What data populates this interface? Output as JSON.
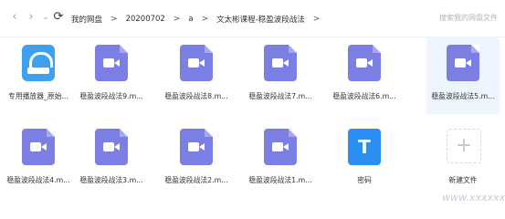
{
  "nav": {
    "back_icon": "chevron-left-icon",
    "forward_icon": "chevron-right-icon",
    "dropdown_icon": "chevron-down-icon",
    "refresh_icon": "refresh-icon"
  },
  "breadcrumb": [
    "我的网盘",
    "20200702",
    "a",
    "文太彬课程-稳盈波段战法"
  ],
  "search": {
    "placeholder": "搜索我的网盘文件"
  },
  "files": [
    {
      "name": "专用播放器_原始...",
      "type": "player"
    },
    {
      "name": "稳盈波段战法9.m...",
      "type": "video"
    },
    {
      "name": "稳盈波段战法8.m...",
      "type": "video"
    },
    {
      "name": "稳盈波段战法7.m...",
      "type": "video"
    },
    {
      "name": "稳盈波段战法6.m...",
      "type": "video"
    },
    {
      "name": "稳盈波段战法5.m...",
      "type": "video",
      "selected": true
    },
    {
      "name": "稳盈波段战法4.m...",
      "type": "video"
    },
    {
      "name": "稳盈波段战法3.m...",
      "type": "video"
    },
    {
      "name": "稳盈波段战法2.m...",
      "type": "video"
    },
    {
      "name": "稳盈波段战法1.m...",
      "type": "video"
    },
    {
      "name": "密码",
      "type": "text",
      "glyph": "T"
    },
    {
      "name": "新建文件",
      "type": "new",
      "glyph": "+"
    }
  ],
  "watermark": "www.xxxxxx"
}
